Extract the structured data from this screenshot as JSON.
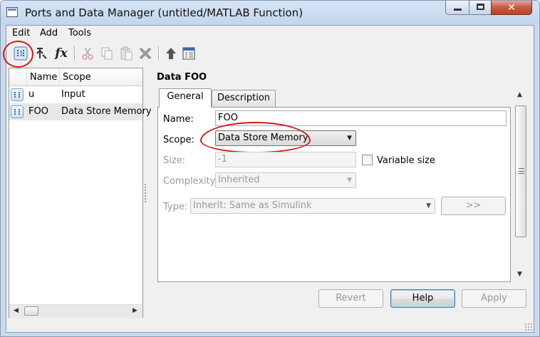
{
  "window": {
    "title": "Ports and Data Manager (untitled/MATLAB Function)",
    "close_glyph": "✕"
  },
  "menu": [
    "Edit",
    "Add",
    "Tools"
  ],
  "toolbar": {
    "icons": [
      "add-data-icon",
      "add-event-icon",
      "add-function-icon",
      "cut-icon",
      "copy-icon",
      "paste-icon",
      "delete-icon",
      "move-up-icon",
      "model-explorer-icon"
    ],
    "fx_label": "fx"
  },
  "list": {
    "headers": {
      "name": "Name",
      "scope": "Scope"
    },
    "rows": [
      {
        "name": "u",
        "scope": "Input"
      },
      {
        "name": "FOO",
        "scope": "Data Store Memory"
      }
    ]
  },
  "detail": {
    "title": "Data FOO",
    "tabs": [
      "General",
      "Description"
    ],
    "name_label": "Name:",
    "name_value": "FOO",
    "scope_label": "Scope:",
    "scope_value": "Data Store Memory",
    "size_label": "Size:",
    "size_value": "-1",
    "variable_size_label": "Variable size",
    "complexity_label": "Complexity:",
    "complexity_value": "Inherited",
    "type_label": "Type:",
    "type_value": "Inherit: Same as Simulink",
    "type_assistant_label": ">>"
  },
  "buttons": {
    "revert": "Revert",
    "help": "Help",
    "apply": "Apply"
  },
  "annotation_color": "#d81818"
}
